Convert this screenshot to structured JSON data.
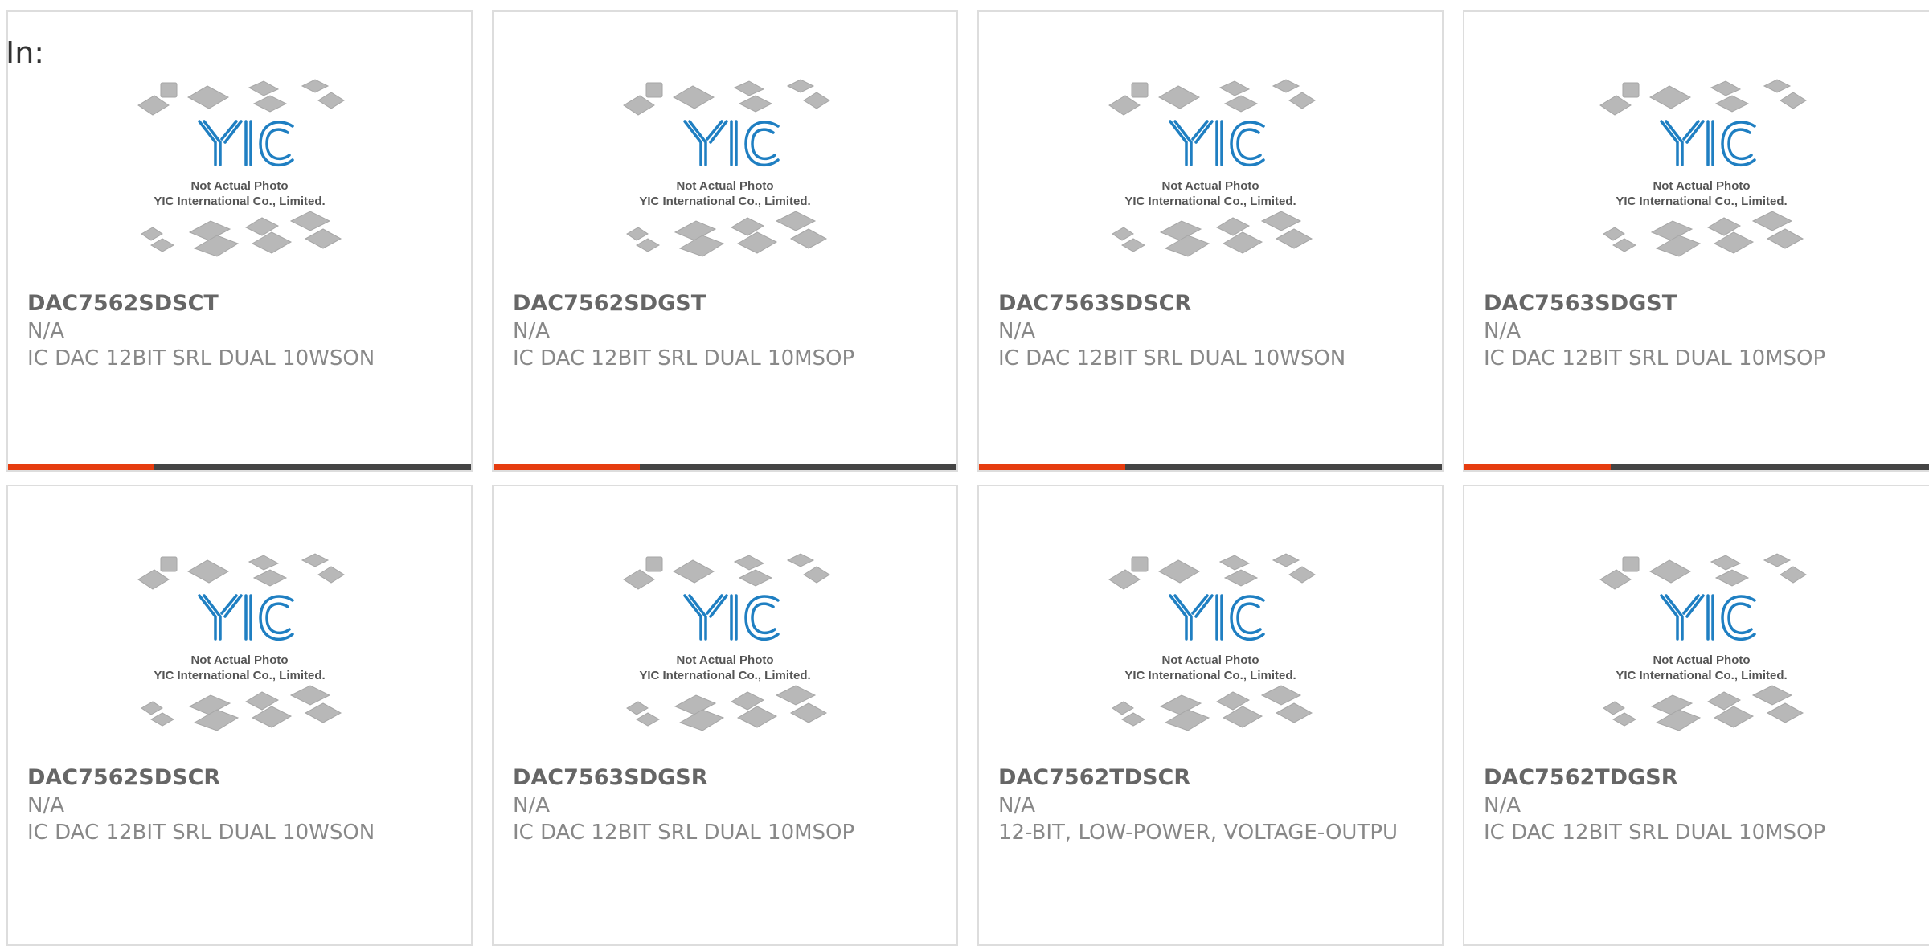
{
  "filter": {
    "label": "In:"
  },
  "placeholder_image": {
    "line1": "Not Actual Photo",
    "line2": "YIC International Co., Limited.",
    "logo_text": "YIC"
  },
  "colors": {
    "accent": "#e63c0f",
    "bar": "#444444",
    "logo": "#1f7fc2",
    "title": "#666666",
    "meta": "#888888"
  },
  "products": [
    {
      "part": "DAC7562SDSCT",
      "mfr": "N/A",
      "desc": "IC DAC 12BIT SRL DUAL 10WSON",
      "has_bar": true
    },
    {
      "part": "DAC7562SDGST",
      "mfr": "N/A",
      "desc": "IC DAC 12BIT SRL DUAL 10MSOP",
      "has_bar": true
    },
    {
      "part": "DAC7563SDSCR",
      "mfr": "N/A",
      "desc": "IC DAC 12BIT SRL DUAL 10WSON",
      "has_bar": true
    },
    {
      "part": "DAC7563SDGST",
      "mfr": "N/A",
      "desc": "IC DAC 12BIT SRL DUAL 10MSOP",
      "has_bar": true
    },
    {
      "part": "DAC7562SDSCR",
      "mfr": "N/A",
      "desc": "IC DAC 12BIT SRL DUAL 10WSON",
      "has_bar": false
    },
    {
      "part": "DAC7563SDGSR",
      "mfr": "N/A",
      "desc": "IC DAC 12BIT SRL DUAL 10MSOP",
      "has_bar": false
    },
    {
      "part": "DAC7562TDSCR",
      "mfr": "N/A",
      "desc": "12-BIT, LOW-POWER, VOLTAGE-OUTPU",
      "has_bar": false
    },
    {
      "part": "DAC7562TDGSR",
      "mfr": "N/A",
      "desc": "IC DAC 12BIT SRL DUAL 10MSOP",
      "has_bar": false
    }
  ]
}
